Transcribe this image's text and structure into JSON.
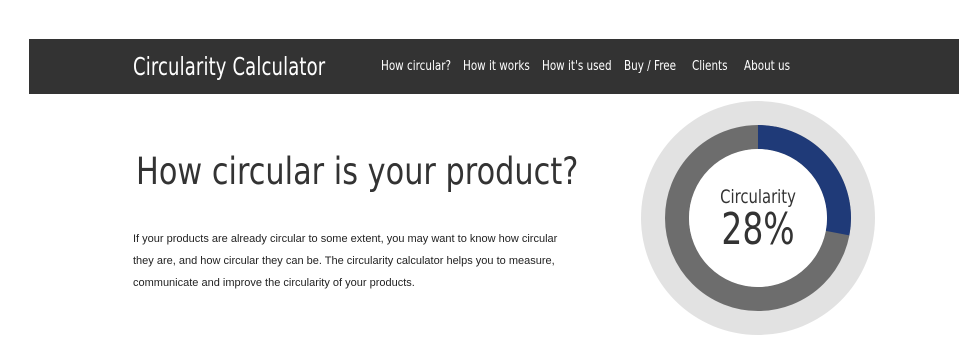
{
  "header": {
    "brand": "Circularity Calculator",
    "nav": [
      "How circular?",
      "How it works",
      "How it's used",
      "Buy / Free",
      "Clients",
      "About us"
    ]
  },
  "hero": {
    "title": "How circular is your product?",
    "paragraph": [
      "If your products are already circular to some extent, you may want to know how circular",
      "they are, and how circular they can be. The circularity calculator helps you to measure,",
      "communicate and improve the circularity of your products."
    ]
  },
  "gauge": {
    "label": "Circularity",
    "value_text": "28%",
    "value_fraction": 0.28,
    "colors": {
      "filled": "#1f3a78",
      "track": "#6d6d6d",
      "outer": "#e2e2e2",
      "inner": "#ffffff"
    }
  }
}
